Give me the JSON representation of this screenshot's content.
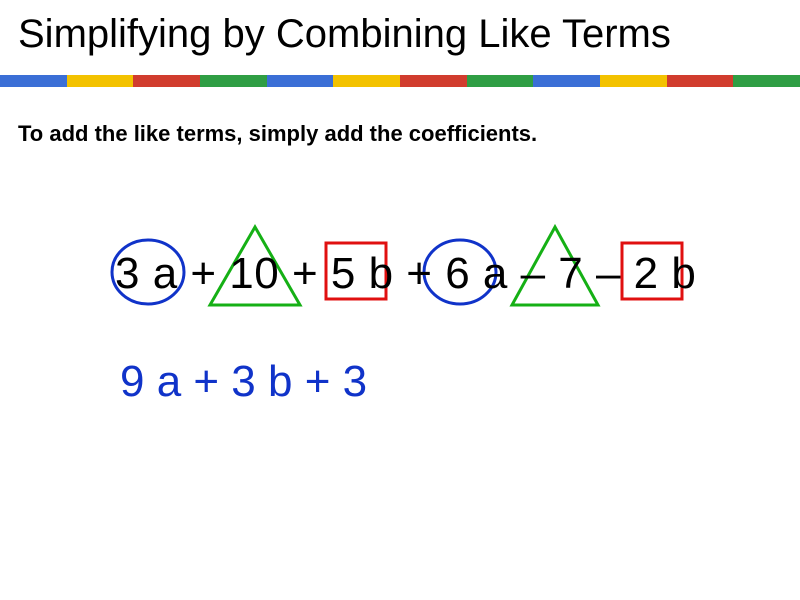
{
  "title": "Simplifying by Combining Like Terms",
  "subtitle": "To add the like terms, simply add the coefficients.",
  "expression": "3 a + 10 + 5 b + 6 a – 7 – 2 b",
  "answer": "9 a + 3 b + 3",
  "stripe_colors": [
    "#3b6fd6",
    "#f3c200",
    "#d13c2e",
    "#2f9e44"
  ],
  "shape_colors": {
    "circle": "#1033c9",
    "triangle": "#15b015",
    "square": "#e01010"
  },
  "like_term_groups": [
    {
      "shape": "circle",
      "terms": [
        "3a",
        "6a"
      ]
    },
    {
      "shape": "triangle",
      "terms": [
        "10",
        "-7"
      ]
    },
    {
      "shape": "square",
      "terms": [
        "5b",
        "-2b"
      ]
    }
  ]
}
